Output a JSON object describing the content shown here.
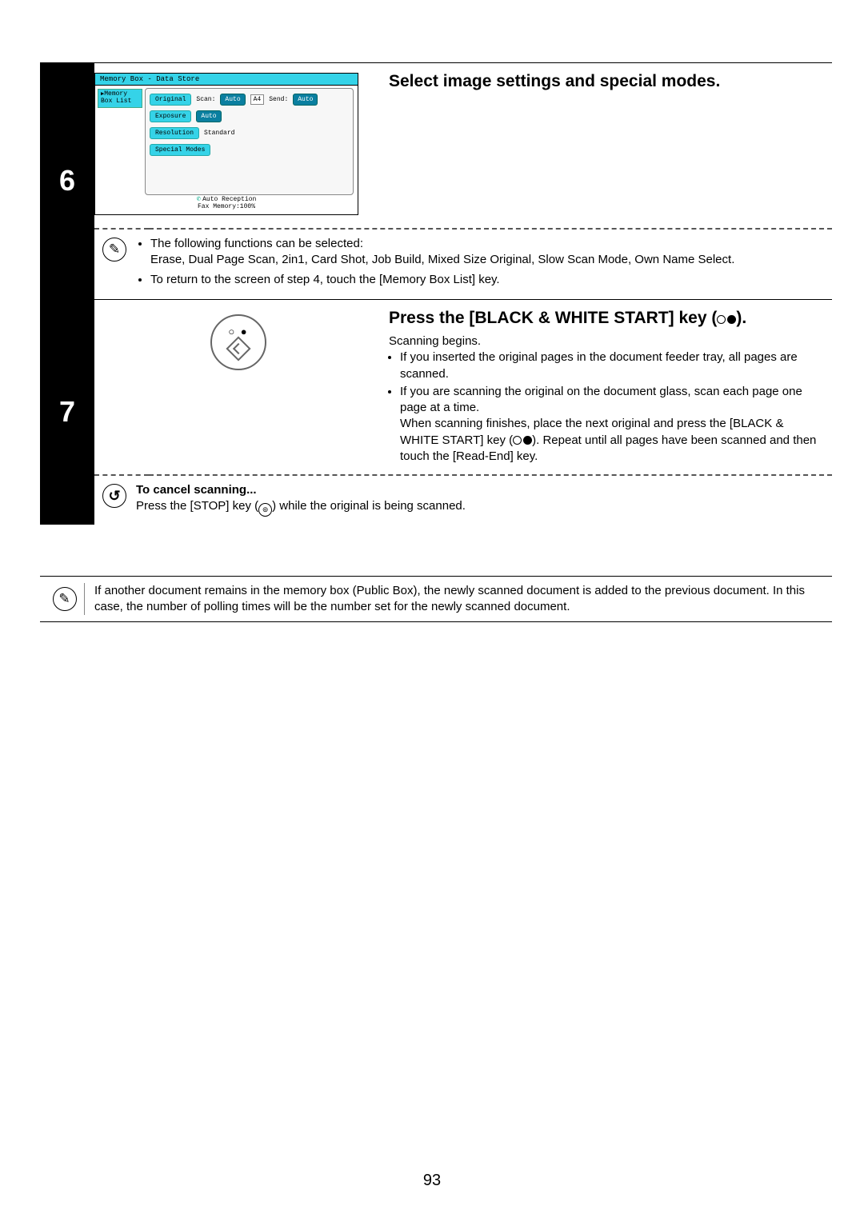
{
  "page_number": "93",
  "step6": {
    "number": "6",
    "heading": "Select image settings and special modes.",
    "screen": {
      "title": "Memory Box - Data Store",
      "memory_box_list": "Memory Box List",
      "original": "Original",
      "scan_label": "Scan:",
      "scan_auto": "Auto",
      "scan_size": "A4",
      "send_label": "Send:",
      "send_auto": "Auto",
      "exposure": "Exposure",
      "exposure_val": "Auto",
      "resolution": "Resolution",
      "resolution_val": "Standard",
      "special_modes": "Special Modes",
      "auto_reception": "Auto Reception",
      "fax_memory": "Fax Memory:100%"
    },
    "note_line1": "The following functions can be selected:",
    "note_line2": "Erase, Dual Page Scan, 2in1, Card Shot, Job Build, Mixed Size Original, Slow Scan Mode, Own Name Select.",
    "note_line3": "To return to the screen of step 4, touch the [Memory Box List] key."
  },
  "step7": {
    "number": "7",
    "heading_pre": "Press the [BLACK & WHITE START] key (",
    "heading_post": ").",
    "scanning_begins": "Scanning begins.",
    "bullet1": "If you inserted the original pages in the document feeder tray, all pages are scanned.",
    "bullet2a": "If you are scanning the original on the document glass, scan each page one page at a time.",
    "bullet2b_pre": "When scanning finishes, place the next original and press the [BLACK & WHITE START] key (",
    "bullet2b_post": "). Repeat until all pages have been scanned and then touch the [Read-End] key.",
    "cancel_title": "To cancel scanning...",
    "cancel_pre": "Press the [STOP] key (",
    "cancel_post": ") while the original is being scanned."
  },
  "info_box": "If another document remains in the memory box (Public Box), the newly scanned document is added to the previous document. In this case, the number of polling times will be the number set for the newly scanned document."
}
